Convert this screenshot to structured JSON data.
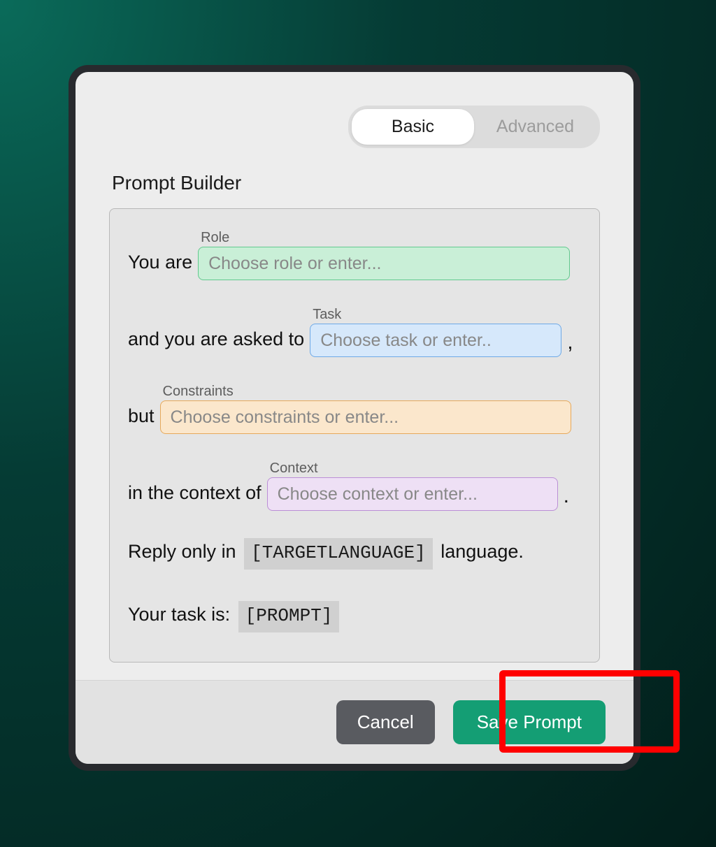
{
  "tabs": {
    "basic": "Basic",
    "advanced": "Advanced"
  },
  "title": "Prompt Builder",
  "builder": {
    "line1_prefix": "You are",
    "role_label": "Role",
    "role_placeholder": "Choose role or enter...",
    "line2_prefix": "and you are asked to",
    "task_label": "Task",
    "task_placeholder": "Choose task or enter..",
    "line3_prefix": "but",
    "constraints_label": "Constraints",
    "constraints_placeholder": "Choose constraints or enter...",
    "line4_prefix": "in the context of",
    "context_label": "Context",
    "context_placeholder": "Choose context or enter...",
    "reply_prefix": "Reply only in",
    "reply_token": "[TARGETLANGUAGE]",
    "reply_suffix": " language.",
    "task_line_prefix": "Your task is:",
    "task_token": "[PROMPT]"
  },
  "footer": {
    "cancel": "Cancel",
    "save": "Save Prompt"
  },
  "punct_comma": ",",
  "punct_period": "."
}
